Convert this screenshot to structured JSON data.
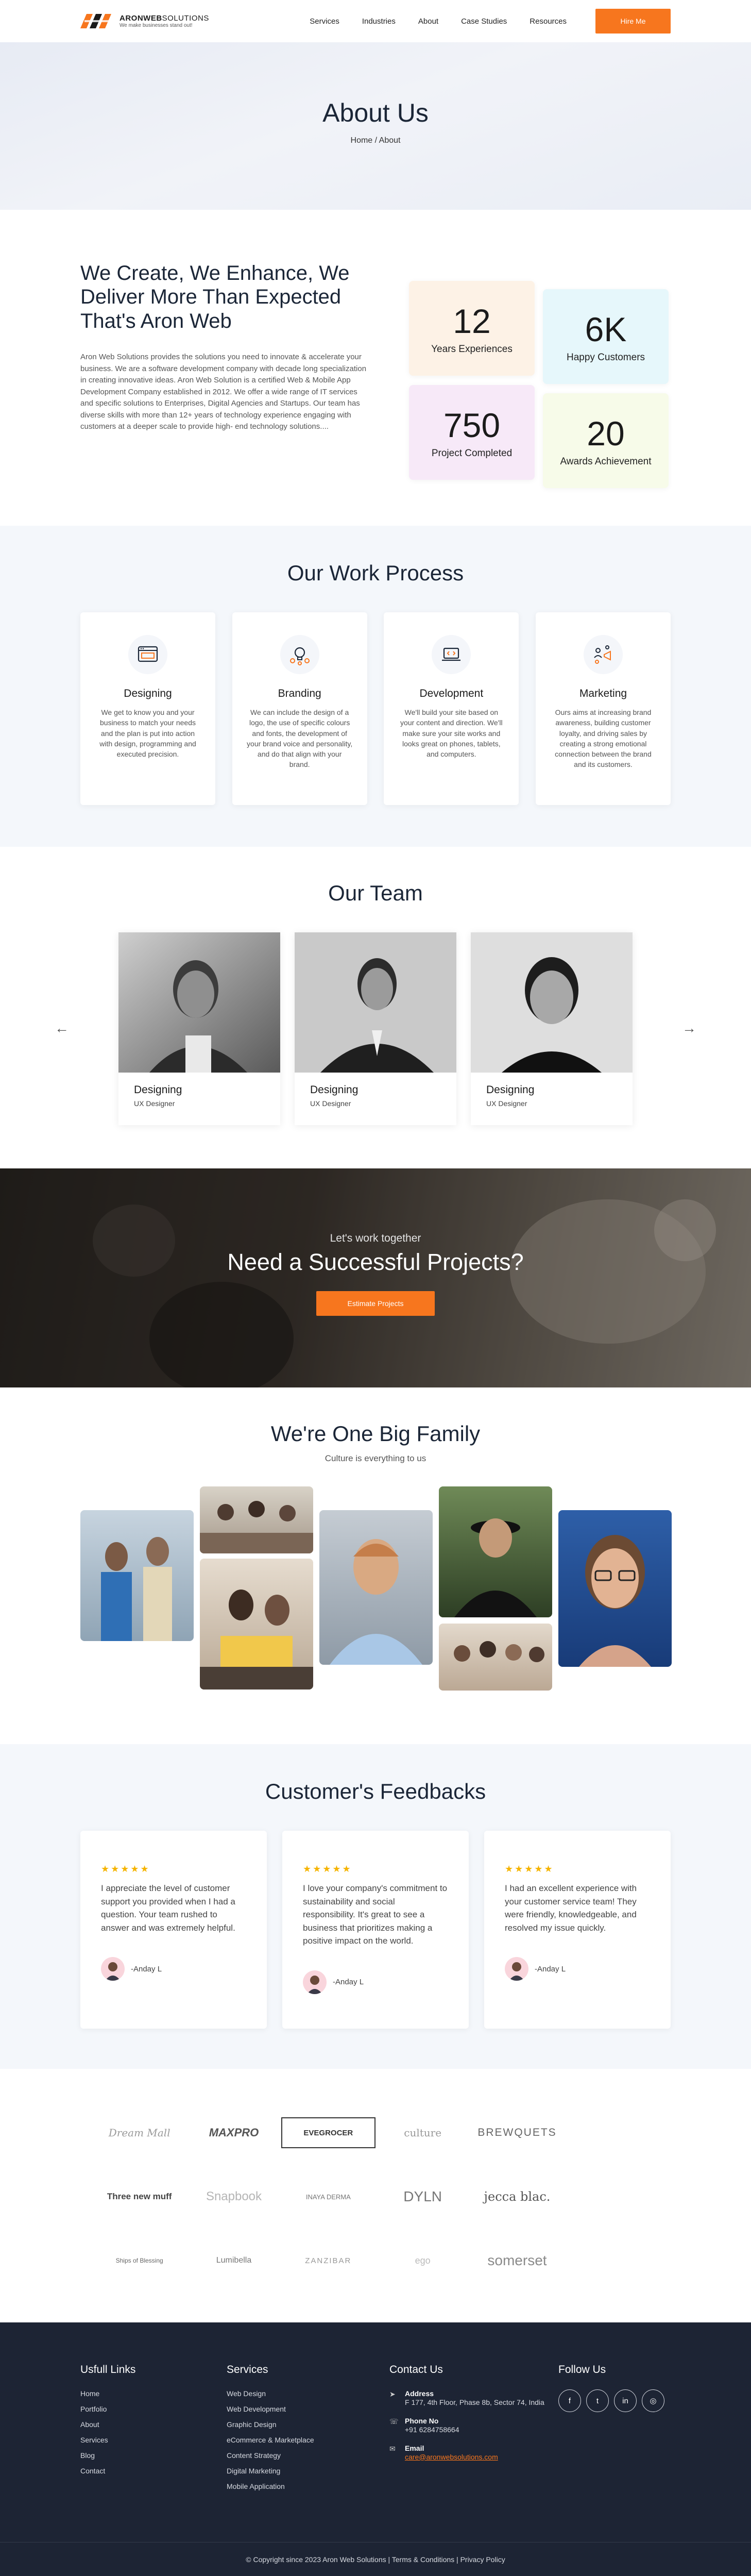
{
  "header": {
    "logo_name_bold": "ARONWEB",
    "logo_name_light": "SOLUTIONS",
    "logo_tagline": "We make businesses stand out!",
    "nav": [
      "Services",
      "Industries",
      "About",
      "Case Studies",
      "Resources"
    ],
    "hire_label": "Hire Me",
    "accent": "#f7761e"
  },
  "hero": {
    "title": "About Us",
    "crumb_home": "Home",
    "crumb_sep": " / ",
    "crumb_current": "About"
  },
  "about": {
    "heading": "We Create, We Enhance, We Deliver More Than Expected That's Aron Web",
    "body": "Aron Web Solutions provides the solutions you need to innovate & accelerate your business. We are a software development company with decade long specialization in creating innovative ideas. Aron Web Solution is a certified Web & Mobile App Development Company established in 2012. We offer a wide range of IT services and specific solutions to Enterprises, Digital Agencies and Startups. Our team has diverse skills with more than 12+ years of technology experience engaging with customers at a deeper scale to provide high- end technology solutions....",
    "stats": [
      {
        "num": "12",
        "label": "Years Experiences"
      },
      {
        "num": "6K",
        "label": "Happy Customers"
      },
      {
        "num": "750",
        "label": "Project Completed"
      },
      {
        "num": "20",
        "label": "Awards Achievement"
      }
    ]
  },
  "process": {
    "title": "Our Work Process",
    "cards": [
      {
        "icon": "browser-icon",
        "title": "Designing",
        "text": "We get to know you and your business to match your needs and the plan is put into action with design, programming and executed precision."
      },
      {
        "icon": "idea-bulb-icon",
        "title": "Branding",
        "text": "We can include the design of a logo, the use of specific colours and fonts, the development of your brand voice and personality, and do that align with your brand."
      },
      {
        "icon": "laptop-code-icon",
        "title": "Development",
        "text": "We'll build your site based on your content and direction. We'll make sure your site works and looks great on phones, tablets, and computers."
      },
      {
        "icon": "marketing-icon",
        "title": "Marketing",
        "text": "Ours aims at increasing brand awareness, building customer loyalty, and driving sales by creating a strong emotional connection between the brand and its customers."
      }
    ]
  },
  "team": {
    "title": "Our Team",
    "members": [
      {
        "name": "Designing",
        "role": "UX Designer"
      },
      {
        "name": "Designing",
        "role": "UX Designer"
      },
      {
        "name": "Designing",
        "role": "UX Designer"
      }
    ],
    "prev": "←",
    "next": "→"
  },
  "cta": {
    "pre": "Let's work together",
    "title": "Need a Successful Projects?",
    "button": "Estimate Projects"
  },
  "family": {
    "title": "We're One Big Family",
    "subtitle": "Culture is everything to us"
  },
  "feedback": {
    "title": "Customer's Feedbacks",
    "stars": "★★★★★",
    "items": [
      {
        "text": "I appreciate the level of customer support you provided when I had a question. Your team rushed to answer and was extremely helpful.",
        "author": "-Anday L"
      },
      {
        "text": "I love your company's commitment to sustainability and social responsibility. It's great to see a business that prioritizes making a positive impact on the world.",
        "author": "-Anday L"
      },
      {
        "text": "I had an excellent experience with your customer service team! They were friendly, knowledgeable, and resolved my issue quickly.",
        "author": "-Anday L"
      }
    ]
  },
  "logos": [
    "Dream Mall",
    "MAXPRO",
    "EVEGROCER",
    "culture",
    "BREWQUETS",
    "Three new muff",
    "Snapbook",
    "INAYA DERMA",
    "DYLN",
    "jecca blac.",
    "Ships of Blessing",
    "Lumibella",
    "ZANZIBAR",
    "ego",
    "somerset"
  ],
  "footer": {
    "useful_title": "Usfull Links",
    "useful": [
      "Home",
      "Portfolio",
      "About",
      "Services",
      "Blog",
      "Contact"
    ],
    "services_title": "Services",
    "services": [
      "Web Design",
      "Web Development",
      "Graphic Design",
      "eCommerce & Marketplace",
      "Content Strategy",
      "Digital Marketing",
      "Mobile Application"
    ],
    "contact_title": "Contact Us",
    "address_label": "Address",
    "address": "F 177, 4th Floor, Phase 8b, Sector 74, India",
    "phone_label": "Phone No",
    "phone": "+91 6284758664",
    "email_label": "Email",
    "email": "care@aronwebsolutions.com",
    "follow_title": "Follow Us",
    "social": [
      {
        "icon": "facebook-icon",
        "glyph": "f"
      },
      {
        "icon": "twitter-icon",
        "glyph": "t"
      },
      {
        "icon": "linkedin-icon",
        "glyph": "in"
      },
      {
        "icon": "instagram-icon",
        "glyph": "◎"
      }
    ],
    "copyright": "© Copyright since 2023 Aron Web Solutions | Terms & Conditions | Privacy Policy"
  }
}
